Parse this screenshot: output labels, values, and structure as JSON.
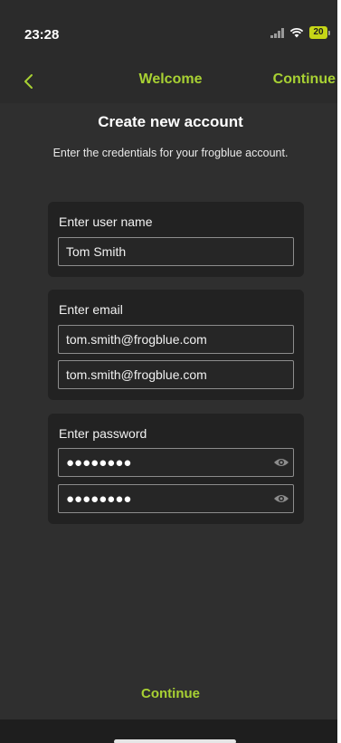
{
  "status_bar": {
    "time": "23:28",
    "battery": "20"
  },
  "nav": {
    "title": "Welcome",
    "continue_label": "Continue"
  },
  "page": {
    "title": "Create new account",
    "subtitle": "Enter the credentials for your frogblue account."
  },
  "username_section": {
    "label": "Enter user name",
    "value": "Tom Smith"
  },
  "email_section": {
    "label": "Enter email",
    "value": "tom.smith@frogblue.com",
    "confirm_value": "tom.smith@frogblue.com"
  },
  "password_section": {
    "label": "Enter password",
    "mask": "●●●●●●●●",
    "confirm_mask": "●●●●●●●●"
  },
  "footer": {
    "continue_label": "Continue"
  },
  "colors": {
    "accent": "#a8d133",
    "background": "#2f2f2f",
    "card": "#222222",
    "battery": "#c6d617"
  }
}
